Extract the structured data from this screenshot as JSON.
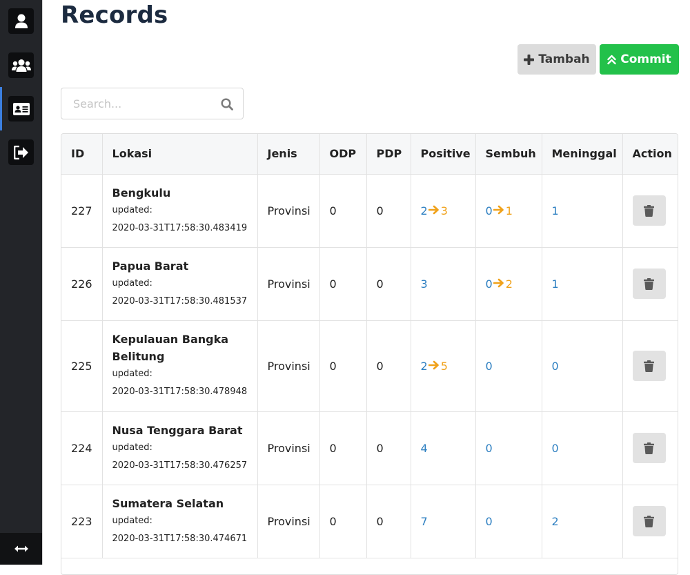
{
  "page": {
    "title": "Records"
  },
  "sidebar": {
    "items": [
      {
        "name": "user-icon"
      },
      {
        "name": "users-icon"
      },
      {
        "name": "id-card-icon"
      },
      {
        "name": "sign-out-icon"
      }
    ],
    "footer_icon": "expand-arrows-icon"
  },
  "toolbar": {
    "add_label": "Tambah",
    "commit_label": "Commit"
  },
  "search": {
    "placeholder": "Search..."
  },
  "table": {
    "headers": [
      "ID",
      "Lokasi",
      "Jenis",
      "ODP",
      "PDP",
      "Positive",
      "Sembuh",
      "Meninggal",
      "Action"
    ],
    "rows": [
      {
        "id": "227",
        "lokasi": "Bengkulu",
        "updated_label": "updated:",
        "updated": "2020-03-31T17:58:30.483419",
        "jenis": "Provinsi",
        "odp": "0",
        "pdp": "0",
        "positive_from": "2",
        "positive_to": "3",
        "sembuh_from": "0",
        "sembuh_to": "1",
        "meninggal": "1"
      },
      {
        "id": "226",
        "lokasi": "Papua Barat",
        "updated_label": "updated:",
        "updated": "2020-03-31T17:58:30.481537",
        "jenis": "Provinsi",
        "odp": "0",
        "pdp": "0",
        "positive_from": "3",
        "positive_to": "",
        "sembuh_from": "0",
        "sembuh_to": "2",
        "meninggal": "1"
      },
      {
        "id": "225",
        "lokasi": "Kepulauan Bangka Belitung",
        "updated_label": "updated:",
        "updated": "2020-03-31T17:58:30.478948",
        "jenis": "Provinsi",
        "odp": "0",
        "pdp": "0",
        "positive_from": "2",
        "positive_to": "5",
        "sembuh_from": "0",
        "sembuh_to": "",
        "meninggal": "0"
      },
      {
        "id": "224",
        "lokasi": "Nusa Tenggara Barat",
        "updated_label": "updated:",
        "updated": "2020-03-31T17:58:30.476257",
        "jenis": "Provinsi",
        "odp": "0",
        "pdp": "0",
        "positive_from": "4",
        "positive_to": "",
        "sembuh_from": "0",
        "sembuh_to": "",
        "meninggal": "0"
      },
      {
        "id": "223",
        "lokasi": "Sumatera Selatan",
        "updated_label": "updated:",
        "updated": "2020-03-31T17:58:30.474671",
        "jenis": "Provinsi",
        "odp": "0",
        "pdp": "0",
        "positive_from": "7",
        "positive_to": "",
        "sembuh_from": "0",
        "sembuh_to": "",
        "meninggal": "2"
      }
    ]
  },
  "colors": {
    "accent_blue": "#2d7fc1",
    "change_orange": "#f0a21b",
    "commit_green": "#23c14a",
    "sidebar_bg": "#232529"
  }
}
